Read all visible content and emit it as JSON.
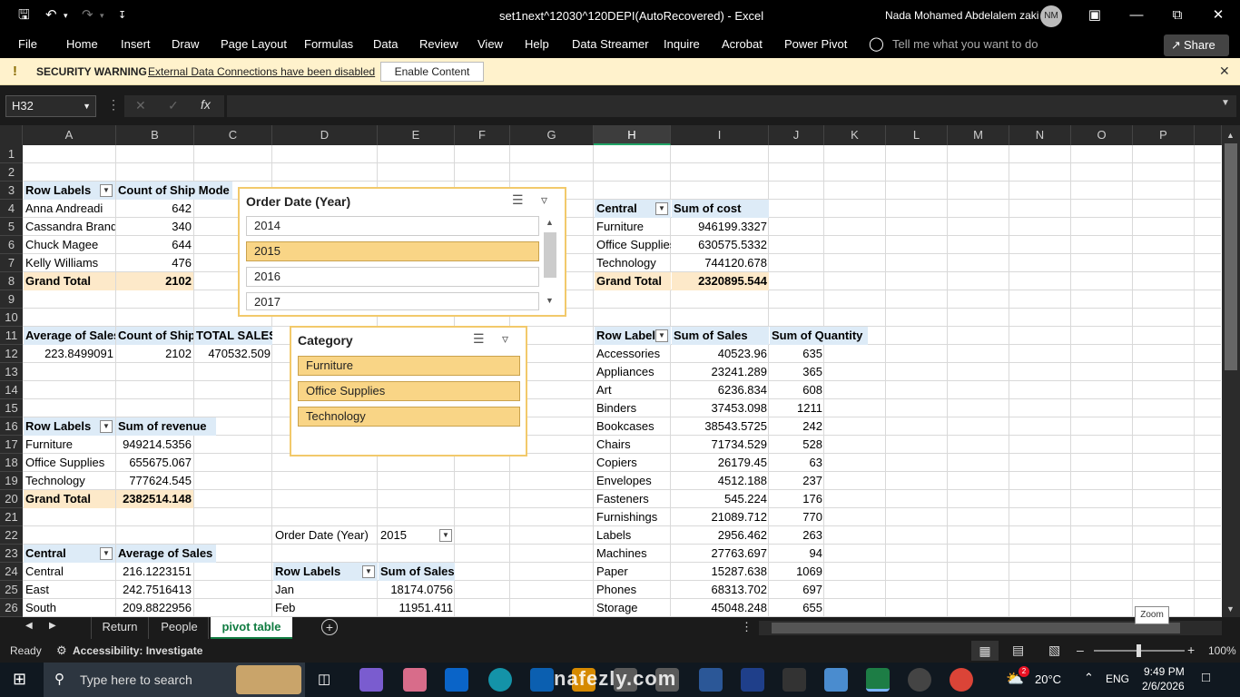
{
  "titlebar": {
    "doc_title": "set1next^12030^120DEPI(AutoRecovered)  -  Excel",
    "user_name": "Nada Mohamed Abdelalem zaki",
    "avatar_initials": "NM"
  },
  "ribbon": {
    "tabs": [
      "File",
      "Home",
      "Insert",
      "Draw",
      "Page Layout",
      "Formulas",
      "Data",
      "Review",
      "View",
      "Help",
      "Data Streamer",
      "Inquire",
      "Acrobat",
      "Power Pivot"
    ],
    "tell_me": "Tell me what you want to do",
    "share": "Share"
  },
  "security": {
    "label": "SECURITY WARNING",
    "message": "External Data Connections have been disabled",
    "button": "Enable Content"
  },
  "formula_bar": {
    "name_box": "H32",
    "formula": ""
  },
  "columns": [
    "A",
    "B",
    "C",
    "D",
    "E",
    "F",
    "G",
    "H",
    "I",
    "J",
    "K",
    "L",
    "M",
    "N",
    "O",
    "P"
  ],
  "rows": [
    "1",
    "2",
    "3",
    "4",
    "5",
    "6",
    "7",
    "8",
    "9",
    "10",
    "11",
    "12",
    "13",
    "14",
    "15",
    "16",
    "17",
    "18",
    "19",
    "20",
    "21",
    "22",
    "23",
    "24",
    "25",
    "26"
  ],
  "pivot1": {
    "h1": "Row Labels",
    "h2": "Count of Ship Mode",
    "rows": [
      [
        "Anna Andreadi",
        "642"
      ],
      [
        "Cassandra Brand",
        "340"
      ],
      [
        "Chuck Magee",
        "644"
      ],
      [
        "Kelly Williams",
        "476"
      ]
    ],
    "total": [
      "Grand Total",
      "2102"
    ]
  },
  "summary": {
    "h1": "Average of Sales",
    "h2": "Count of Ship",
    "h3": "TOTAL SALES",
    "v1": "223.8499091",
    "v2": "2102",
    "v3": "470532.509"
  },
  "pivot2": {
    "h1": "Row Labels",
    "h2": "Sum of revenue",
    "rows": [
      [
        "Furniture",
        "949214.5356"
      ],
      [
        "Office Supplies",
        "655675.067"
      ],
      [
        "Technology",
        "777624.545"
      ]
    ],
    "total": [
      "Grand Total",
      "2382514.148"
    ]
  },
  "pivot3": {
    "h1": "Central",
    "h2": "Average of Sales",
    "rows": [
      [
        "Central",
        "216.1223151"
      ],
      [
        "East",
        "242.7516413"
      ],
      [
        "South",
        "209.8822956"
      ]
    ]
  },
  "pivot4": {
    "filter_label": "Order Date (Year)",
    "filter_value": "2015",
    "h1": "Row Labels",
    "h2": "Sum of Sales",
    "rows": [
      [
        "Jan",
        "18174.0756"
      ],
      [
        "Feb",
        "11951.411"
      ]
    ]
  },
  "pivot5": {
    "h1": "Central",
    "h2": "Sum of cost",
    "rows": [
      [
        "Furniture",
        "946199.3327"
      ],
      [
        "Office Supplies",
        "630575.5332"
      ],
      [
        "Technology",
        "744120.678"
      ]
    ],
    "total": [
      "Grand Total",
      "2320895.544"
    ]
  },
  "pivot6": {
    "h1": "Row Labels",
    "h2": "Sum of Sales",
    "h3": "Sum of Quantity",
    "rows": [
      [
        "Accessories",
        "40523.96",
        "635"
      ],
      [
        "Appliances",
        "23241.289",
        "365"
      ],
      [
        "Art",
        "6236.834",
        "608"
      ],
      [
        "Binders",
        "37453.098",
        "1211"
      ],
      [
        "Bookcases",
        "38543.5725",
        "242"
      ],
      [
        "Chairs",
        "71734.529",
        "528"
      ],
      [
        "Copiers",
        "26179.45",
        "63"
      ],
      [
        "Envelopes",
        "4512.188",
        "237"
      ],
      [
        "Fasteners",
        "545.224",
        "176"
      ],
      [
        "Furnishings",
        "21089.712",
        "770"
      ],
      [
        "Labels",
        "2956.462",
        "263"
      ],
      [
        "Machines",
        "27763.697",
        "94"
      ],
      [
        "Paper",
        "15287.638",
        "1069"
      ],
      [
        "Phones",
        "68313.702",
        "697"
      ],
      [
        "Storage",
        "45048.248",
        "655"
      ]
    ]
  },
  "slicer_year": {
    "title": "Order Date (Year)",
    "items": [
      "2014",
      "2015",
      "2016",
      "2017"
    ],
    "selected": "2015"
  },
  "slicer_category": {
    "title": "Category",
    "items": [
      "Furniture",
      "Office Supplies",
      "Technology"
    ]
  },
  "sheets": {
    "tabs": [
      "Return",
      "People",
      "pivot table"
    ],
    "active": "pivot table"
  },
  "status": {
    "ready": "Ready",
    "accessibility": "Accessibility: Investigate",
    "zoom": "100%",
    "zoom_tooltip": "Zoom"
  },
  "taskbar": {
    "search_placeholder": "Type here to search",
    "weather": "20°C",
    "lang": "ENG",
    "time": "9:49 PM",
    "date": "2/6/2026",
    "weather_badge": "2"
  },
  "watermark": {
    "text": "nafezly.com"
  }
}
